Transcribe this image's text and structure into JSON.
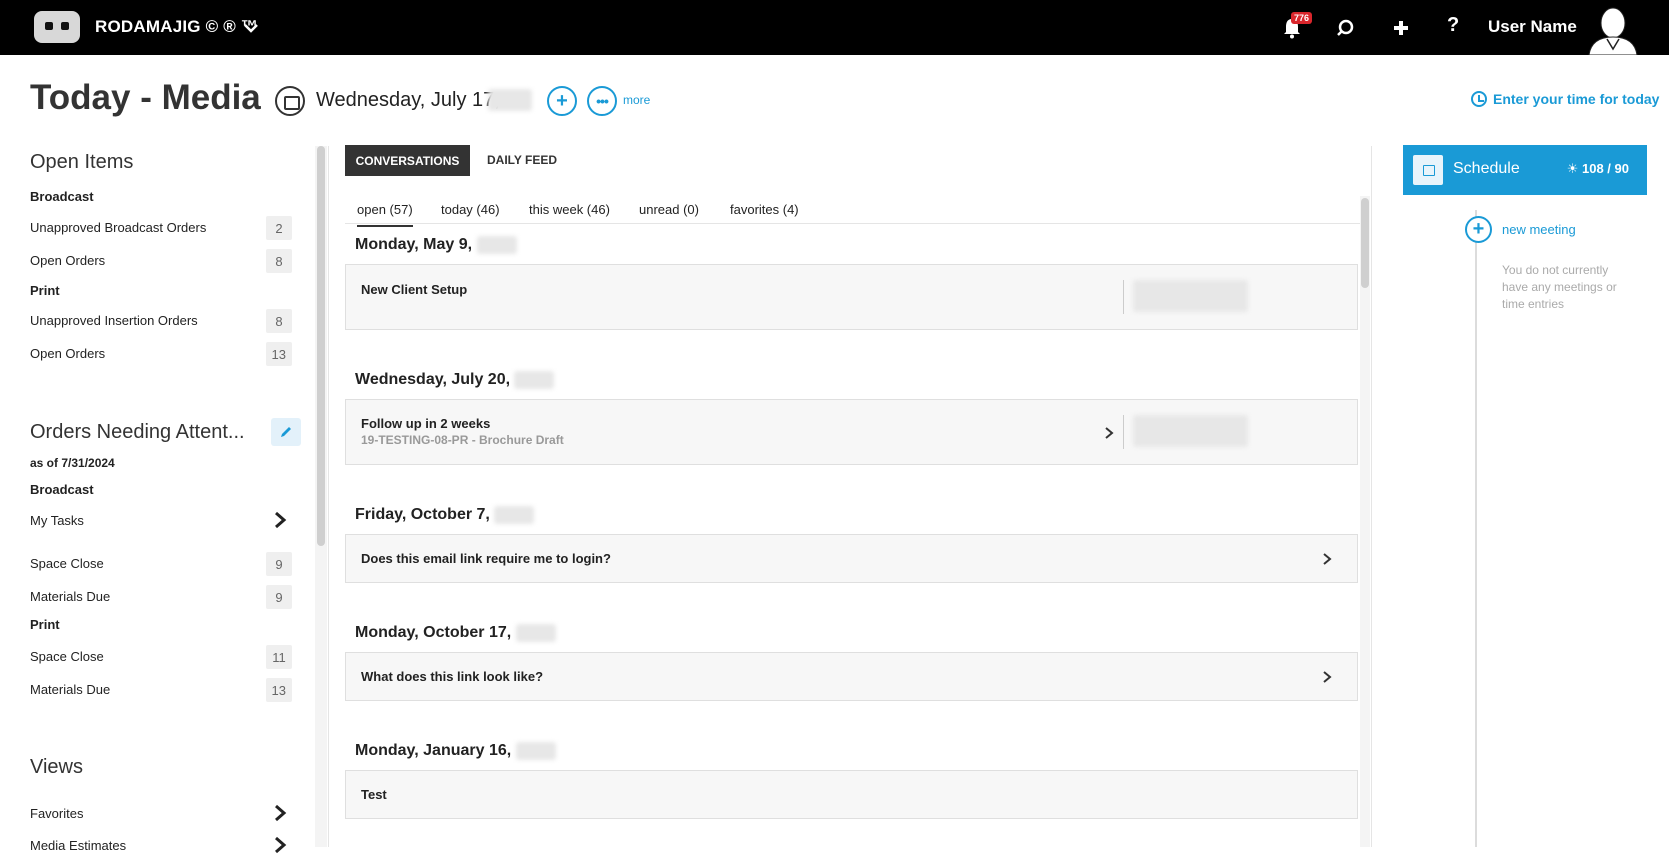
{
  "topbar": {
    "brand": "RODAMAJIG © ® ™",
    "notifications_count": "776",
    "username": "User Name",
    "icons": [
      "robot-logo-icon",
      "chevron-down-icon",
      "bell-icon",
      "search-icon",
      "plus-icon",
      "help-icon",
      "avatar"
    ]
  },
  "header": {
    "title": "Today - Media",
    "date": "Wednesday, July 17,",
    "more_label": "more",
    "time_link": "Enter your time for today"
  },
  "sidebar": {
    "open_items": {
      "title": "Open Items",
      "groups": [
        {
          "name": "Broadcast",
          "items": [
            {
              "label": "Unapproved Broadcast Orders",
              "count": "2"
            },
            {
              "label": "Open Orders",
              "count": "8"
            }
          ]
        },
        {
          "name": "Print",
          "items": [
            {
              "label": "Unapproved Insertion Orders",
              "count": "8"
            },
            {
              "label": "Open Orders",
              "count": "13"
            }
          ]
        }
      ]
    },
    "attention": {
      "title": "Orders Needing Attent...",
      "as_of": "as of 7/31/2024",
      "broadcast_label": "Broadcast",
      "my_tasks": "My Tasks",
      "broadcast_items": [
        {
          "label": "Space Close",
          "count": "9"
        },
        {
          "label": "Materials Due",
          "count": "9"
        }
      ],
      "print_label": "Print",
      "print_items": [
        {
          "label": "Space Close",
          "count": "11"
        },
        {
          "label": "Materials Due",
          "count": "13"
        }
      ]
    },
    "views": {
      "title": "Views",
      "items": [
        "Favorites",
        "Media Estimates"
      ]
    }
  },
  "main": {
    "tabs": [
      "CONVERSATIONS",
      "DAILY FEED"
    ],
    "filters": [
      "open (57)",
      "today (46)",
      "this week (46)",
      "unread (0)",
      "favorites (4)"
    ],
    "days": [
      {
        "heading": "Monday, May 9,",
        "cards": [
          {
            "title": "New Client Setup",
            "subtitle": ""
          }
        ]
      },
      {
        "heading": "Wednesday, July 20,",
        "cards": [
          {
            "title": "Follow up in 2 weeks",
            "subtitle": "19-TESTING-08-PR - Brochure Draft"
          }
        ]
      },
      {
        "heading": "Friday, October 7,",
        "cards": [
          {
            "title": "Does this email link require me to login?",
            "subtitle": ""
          }
        ]
      },
      {
        "heading": "Monday, October 17,",
        "cards": [
          {
            "title": "What does this link look like?",
            "subtitle": ""
          }
        ]
      },
      {
        "heading": "Monday, January 16,",
        "cards": [
          {
            "title": "Test",
            "subtitle": ""
          }
        ]
      }
    ]
  },
  "schedule": {
    "title": "Schedule",
    "count": "108 / 90",
    "new_meeting": "new meeting",
    "empty_text": "You do not currently have any meetings or time entries"
  },
  "colors": {
    "accent": "#1a9ad6",
    "topbar": "#000000",
    "badge": "#d9262c"
  }
}
